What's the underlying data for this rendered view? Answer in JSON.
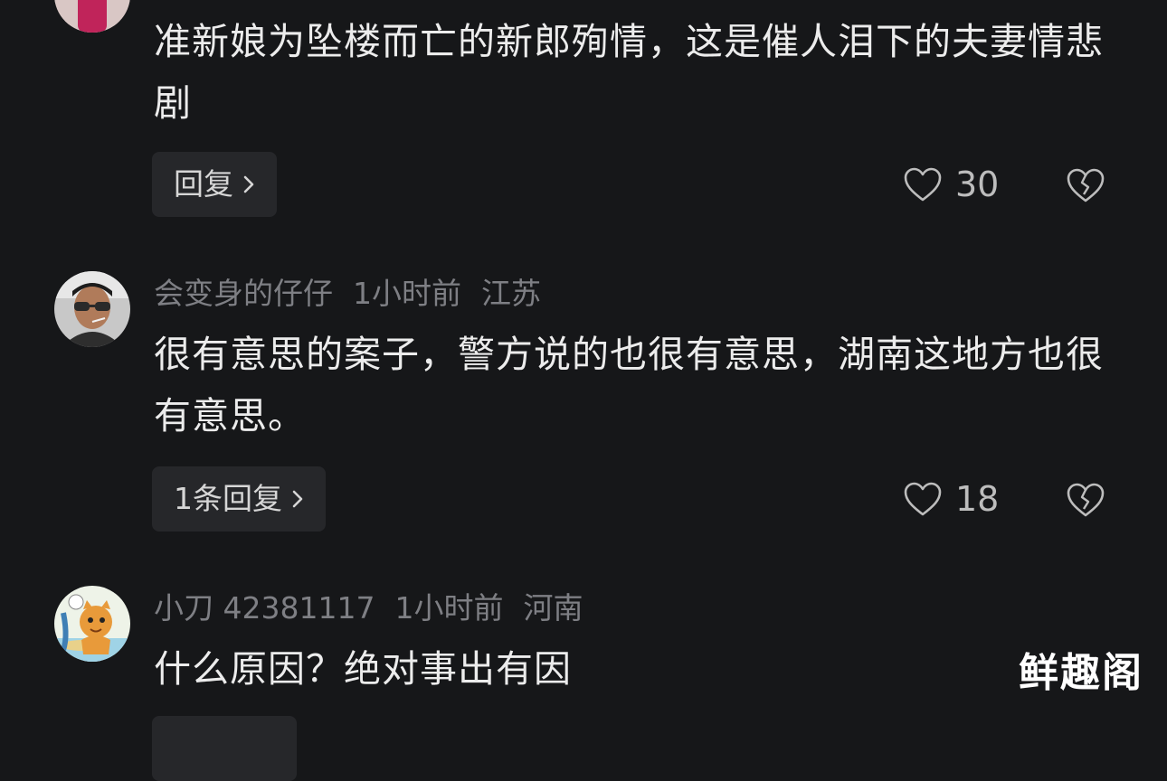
{
  "comments": [
    {
      "user": "",
      "time": "",
      "location": "",
      "text": "准新娘为坠楼而亡的新郎殉情，这是催人泪下的夫妻情悲剧",
      "reply_label": "回复",
      "likes": "30"
    },
    {
      "user": "会变身的仔仔",
      "time": "1小时前",
      "location": "江苏",
      "text": "很有意思的案子，警方说的也很有意思，湖南这地方也很有意思。",
      "reply_label": "1条回复",
      "likes": "18"
    },
    {
      "user": "小刀 42381117",
      "time": "1小时前",
      "location": "河南",
      "text": "什么原因？绝对事出有因",
      "reply_label": "",
      "likes": ""
    }
  ],
  "watermark": "鲜趣阁",
  "colors": {
    "background": "#161719",
    "meta_text": "#7e7f84",
    "body_text": "#ececec",
    "reply_bg": "#26272a"
  },
  "icons": {
    "like": "heart-outline-icon",
    "dislike": "broken-heart-icon",
    "reply_chevron": "chevron-right-icon"
  }
}
